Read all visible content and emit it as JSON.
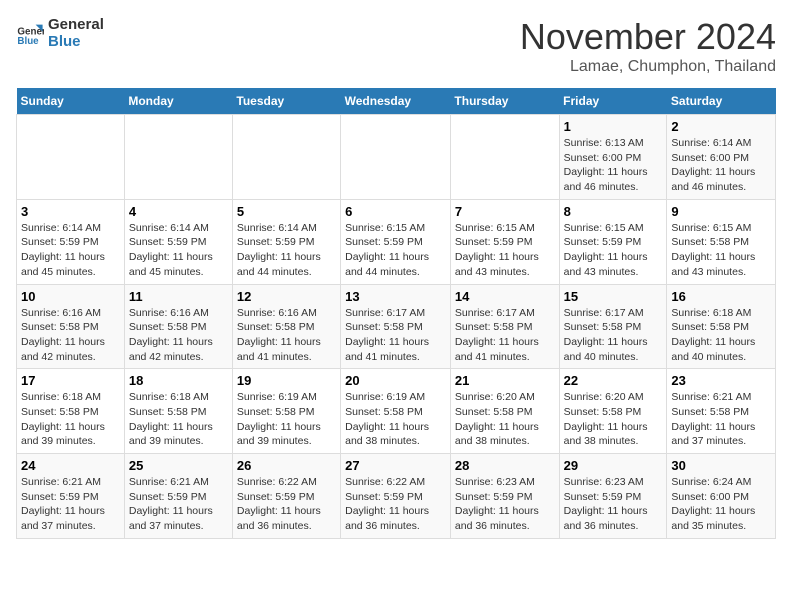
{
  "logo": {
    "line1": "General",
    "line2": "Blue"
  },
  "title": "November 2024",
  "location": "Lamae, Chumphon, Thailand",
  "weekdays": [
    "Sunday",
    "Monday",
    "Tuesday",
    "Wednesday",
    "Thursday",
    "Friday",
    "Saturday"
  ],
  "weeks": [
    [
      {
        "day": "",
        "info": ""
      },
      {
        "day": "",
        "info": ""
      },
      {
        "day": "",
        "info": ""
      },
      {
        "day": "",
        "info": ""
      },
      {
        "day": "",
        "info": ""
      },
      {
        "day": "1",
        "info": "Sunrise: 6:13 AM\nSunset: 6:00 PM\nDaylight: 11 hours\nand 46 minutes."
      },
      {
        "day": "2",
        "info": "Sunrise: 6:14 AM\nSunset: 6:00 PM\nDaylight: 11 hours\nand 46 minutes."
      }
    ],
    [
      {
        "day": "3",
        "info": "Sunrise: 6:14 AM\nSunset: 5:59 PM\nDaylight: 11 hours\nand 45 minutes."
      },
      {
        "day": "4",
        "info": "Sunrise: 6:14 AM\nSunset: 5:59 PM\nDaylight: 11 hours\nand 45 minutes."
      },
      {
        "day": "5",
        "info": "Sunrise: 6:14 AM\nSunset: 5:59 PM\nDaylight: 11 hours\nand 44 minutes."
      },
      {
        "day": "6",
        "info": "Sunrise: 6:15 AM\nSunset: 5:59 PM\nDaylight: 11 hours\nand 44 minutes."
      },
      {
        "day": "7",
        "info": "Sunrise: 6:15 AM\nSunset: 5:59 PM\nDaylight: 11 hours\nand 43 minutes."
      },
      {
        "day": "8",
        "info": "Sunrise: 6:15 AM\nSunset: 5:59 PM\nDaylight: 11 hours\nand 43 minutes."
      },
      {
        "day": "9",
        "info": "Sunrise: 6:15 AM\nSunset: 5:58 PM\nDaylight: 11 hours\nand 43 minutes."
      }
    ],
    [
      {
        "day": "10",
        "info": "Sunrise: 6:16 AM\nSunset: 5:58 PM\nDaylight: 11 hours\nand 42 minutes."
      },
      {
        "day": "11",
        "info": "Sunrise: 6:16 AM\nSunset: 5:58 PM\nDaylight: 11 hours\nand 42 minutes."
      },
      {
        "day": "12",
        "info": "Sunrise: 6:16 AM\nSunset: 5:58 PM\nDaylight: 11 hours\nand 41 minutes."
      },
      {
        "day": "13",
        "info": "Sunrise: 6:17 AM\nSunset: 5:58 PM\nDaylight: 11 hours\nand 41 minutes."
      },
      {
        "day": "14",
        "info": "Sunrise: 6:17 AM\nSunset: 5:58 PM\nDaylight: 11 hours\nand 41 minutes."
      },
      {
        "day": "15",
        "info": "Sunrise: 6:17 AM\nSunset: 5:58 PM\nDaylight: 11 hours\nand 40 minutes."
      },
      {
        "day": "16",
        "info": "Sunrise: 6:18 AM\nSunset: 5:58 PM\nDaylight: 11 hours\nand 40 minutes."
      }
    ],
    [
      {
        "day": "17",
        "info": "Sunrise: 6:18 AM\nSunset: 5:58 PM\nDaylight: 11 hours\nand 39 minutes."
      },
      {
        "day": "18",
        "info": "Sunrise: 6:18 AM\nSunset: 5:58 PM\nDaylight: 11 hours\nand 39 minutes."
      },
      {
        "day": "19",
        "info": "Sunrise: 6:19 AM\nSunset: 5:58 PM\nDaylight: 11 hours\nand 39 minutes."
      },
      {
        "day": "20",
        "info": "Sunrise: 6:19 AM\nSunset: 5:58 PM\nDaylight: 11 hours\nand 38 minutes."
      },
      {
        "day": "21",
        "info": "Sunrise: 6:20 AM\nSunset: 5:58 PM\nDaylight: 11 hours\nand 38 minutes."
      },
      {
        "day": "22",
        "info": "Sunrise: 6:20 AM\nSunset: 5:58 PM\nDaylight: 11 hours\nand 38 minutes."
      },
      {
        "day": "23",
        "info": "Sunrise: 6:21 AM\nSunset: 5:58 PM\nDaylight: 11 hours\nand 37 minutes."
      }
    ],
    [
      {
        "day": "24",
        "info": "Sunrise: 6:21 AM\nSunset: 5:59 PM\nDaylight: 11 hours\nand 37 minutes."
      },
      {
        "day": "25",
        "info": "Sunrise: 6:21 AM\nSunset: 5:59 PM\nDaylight: 11 hours\nand 37 minutes."
      },
      {
        "day": "26",
        "info": "Sunrise: 6:22 AM\nSunset: 5:59 PM\nDaylight: 11 hours\nand 36 minutes."
      },
      {
        "day": "27",
        "info": "Sunrise: 6:22 AM\nSunset: 5:59 PM\nDaylight: 11 hours\nand 36 minutes."
      },
      {
        "day": "28",
        "info": "Sunrise: 6:23 AM\nSunset: 5:59 PM\nDaylight: 11 hours\nand 36 minutes."
      },
      {
        "day": "29",
        "info": "Sunrise: 6:23 AM\nSunset: 5:59 PM\nDaylight: 11 hours\nand 36 minutes."
      },
      {
        "day": "30",
        "info": "Sunrise: 6:24 AM\nSunset: 6:00 PM\nDaylight: 11 hours\nand 35 minutes."
      }
    ]
  ]
}
